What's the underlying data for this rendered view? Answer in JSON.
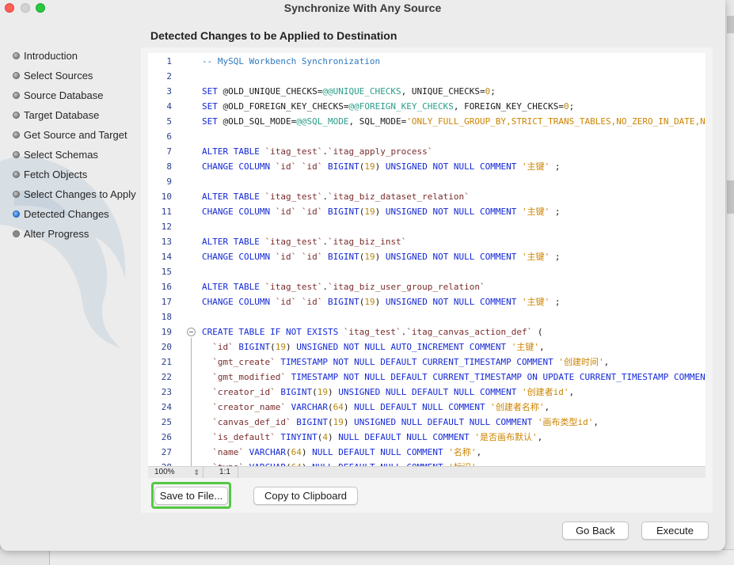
{
  "window": {
    "title": "Synchronize With Any Source"
  },
  "sidebar": {
    "steps": [
      {
        "label": "Introduction",
        "state": "done"
      },
      {
        "label": "Select Sources",
        "state": "done"
      },
      {
        "label": "Source Database",
        "state": "done"
      },
      {
        "label": "Target Database",
        "state": "done"
      },
      {
        "label": "Get Source and Target",
        "state": "done"
      },
      {
        "label": "Select Schemas",
        "state": "done"
      },
      {
        "label": "Fetch Objects",
        "state": "done"
      },
      {
        "label": "Select Changes to Apply",
        "state": "done"
      },
      {
        "label": "Detected Changes",
        "state": "active"
      },
      {
        "label": "Alter Progress",
        "state": "pending"
      }
    ]
  },
  "main": {
    "heading": "Detected Changes to be Applied to Destination",
    "line_numbers": [
      "1",
      "2",
      "3",
      "4",
      "5",
      "6",
      "7",
      "8",
      "9",
      "10",
      "11",
      "12",
      "13",
      "14",
      "15",
      "16",
      "17",
      "18",
      "19",
      "20",
      "21",
      "22",
      "23",
      "24",
      "25",
      "26",
      "27",
      "28"
    ],
    "status": {
      "zoom": "100%",
      "position": "1:1"
    },
    "buttons": {
      "save_to_file": "Save to File...",
      "copy_to_clipboard": "Copy to Clipboard"
    }
  },
  "footer": {
    "go_back": "Go Back",
    "execute": "Execute"
  },
  "colors": {
    "accent_active": "#2b75d6",
    "highlight_border": "#53c943",
    "sql_keyword": "#1428d6",
    "sql_comment": "#2f7abf",
    "sql_string": "#cc8400",
    "line_number": "#2a3f8e"
  }
}
